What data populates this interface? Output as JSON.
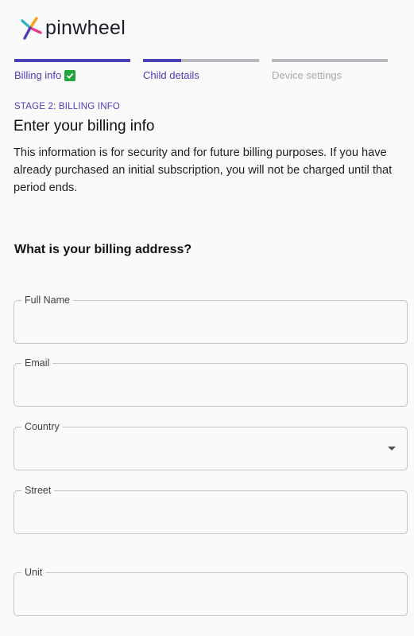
{
  "brand": {
    "name": "pinwheel",
    "accent": "#4b3fb5"
  },
  "stepper": {
    "steps": [
      {
        "label": "Billing info",
        "progress": 1.0,
        "completed": true,
        "icon": "check-icon"
      },
      {
        "label": "Child details",
        "progress": 0.33,
        "completed": false
      },
      {
        "label": "Device settings",
        "progress": 0.0,
        "completed": false
      }
    ]
  },
  "main": {
    "stage": "STAGE 2: BILLING INFO",
    "title": "Enter your billing info",
    "description": "This information is for security and for future billing purposes. If you have already purchased an initial subscription, you will not be charged until that period ends.",
    "question": "What is your billing address?"
  },
  "form": {
    "full_name": {
      "label": "Full Name",
      "value": ""
    },
    "email": {
      "label": "Email",
      "value": ""
    },
    "country": {
      "label": "Country",
      "value": ""
    },
    "street": {
      "label": "Street",
      "value": ""
    },
    "unit": {
      "label": "Unit",
      "value": ""
    }
  }
}
